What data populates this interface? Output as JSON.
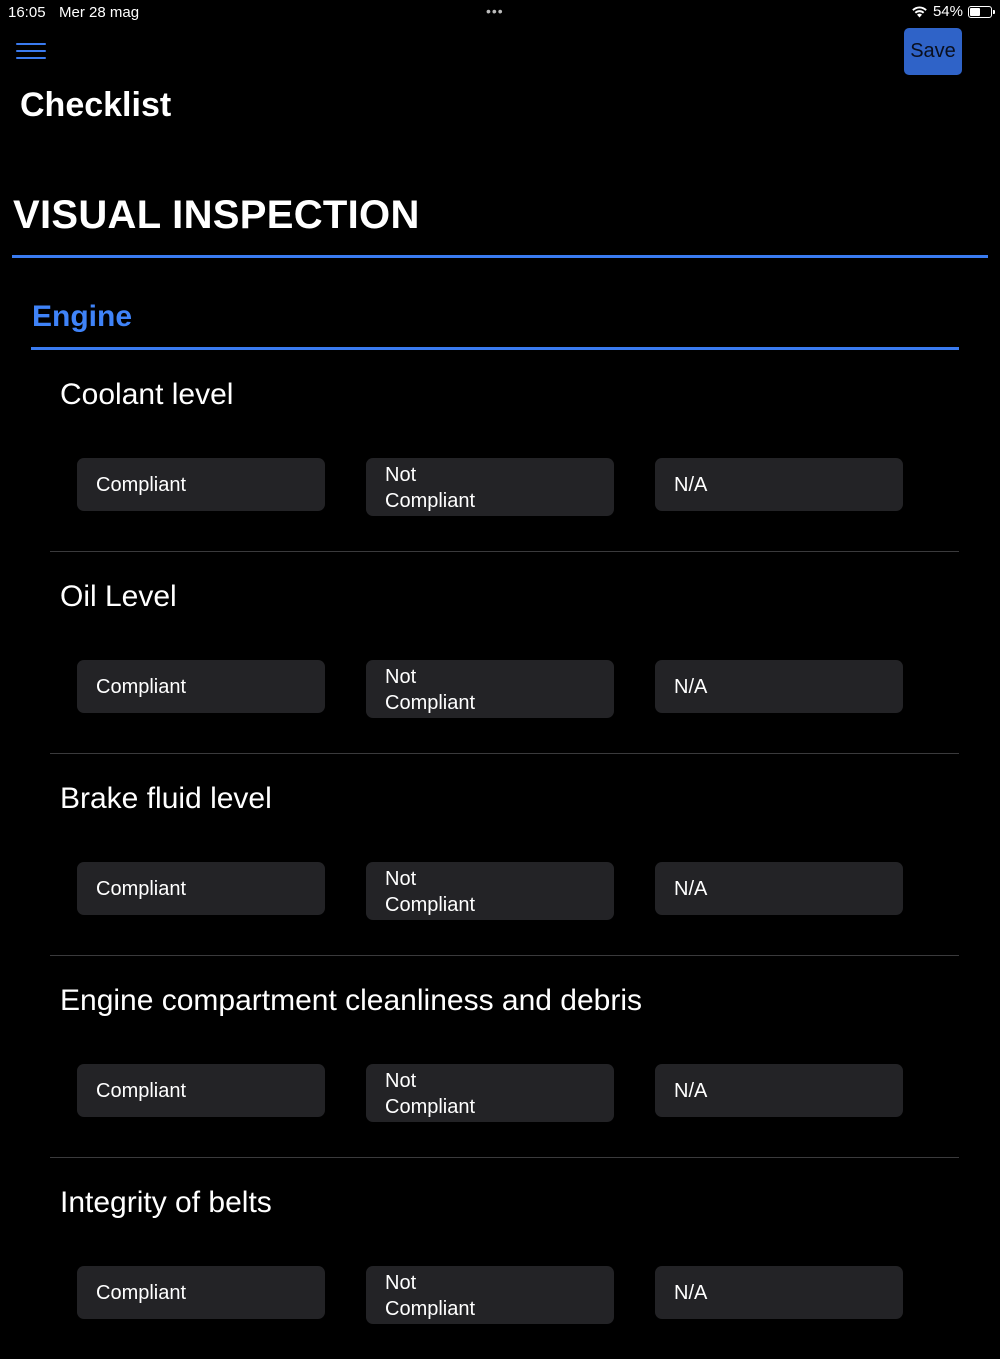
{
  "status_bar": {
    "time": "16:05",
    "date": "Mer 28 mag",
    "dots": "•••",
    "battery": "54%",
    "battery_level": 0.54
  },
  "header": {
    "menu_icon": "hamburger-menu-icon",
    "save_label": "Save",
    "title": "Checklist"
  },
  "section": {
    "title": "VISUAL INSPECTION",
    "group": {
      "title": "Engine",
      "items": [
        {
          "label": "Coolant level"
        },
        {
          "label": "Oil Level"
        },
        {
          "label": "Brake fluid level"
        },
        {
          "label": "Engine compartment cleanliness and debris"
        },
        {
          "label": "Integrity of belts"
        }
      ]
    }
  },
  "options": {
    "compliant": "Compliant",
    "not_compliant_line1": "Not",
    "not_compliant_line2": "Compliant",
    "na": "N/A"
  },
  "colors": {
    "accent": "#3a7bf0",
    "save_button": "#2f63c8",
    "option_bg": "#232326",
    "background": "#000000"
  }
}
